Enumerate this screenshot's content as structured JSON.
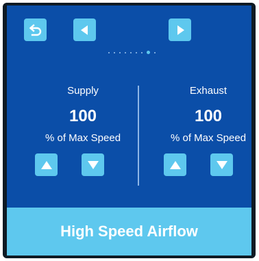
{
  "nav": {
    "back_icon": "back-arrow-icon",
    "prev_icon": "triangle-left-icon",
    "next_icon": "triangle-right-icon",
    "page_total": 8,
    "page_current": 8
  },
  "supply": {
    "label": "Supply",
    "value": "100",
    "unit": "% of Max Speed"
  },
  "exhaust": {
    "label": "Exhaust",
    "value": "100",
    "unit": "% of Max Speed"
  },
  "status": {
    "mode": "High Speed Airflow"
  },
  "colors": {
    "panel": "#0b4ea8",
    "button": "#5ec8ee",
    "frame": "#0e1a24",
    "text": "#ffffff"
  }
}
